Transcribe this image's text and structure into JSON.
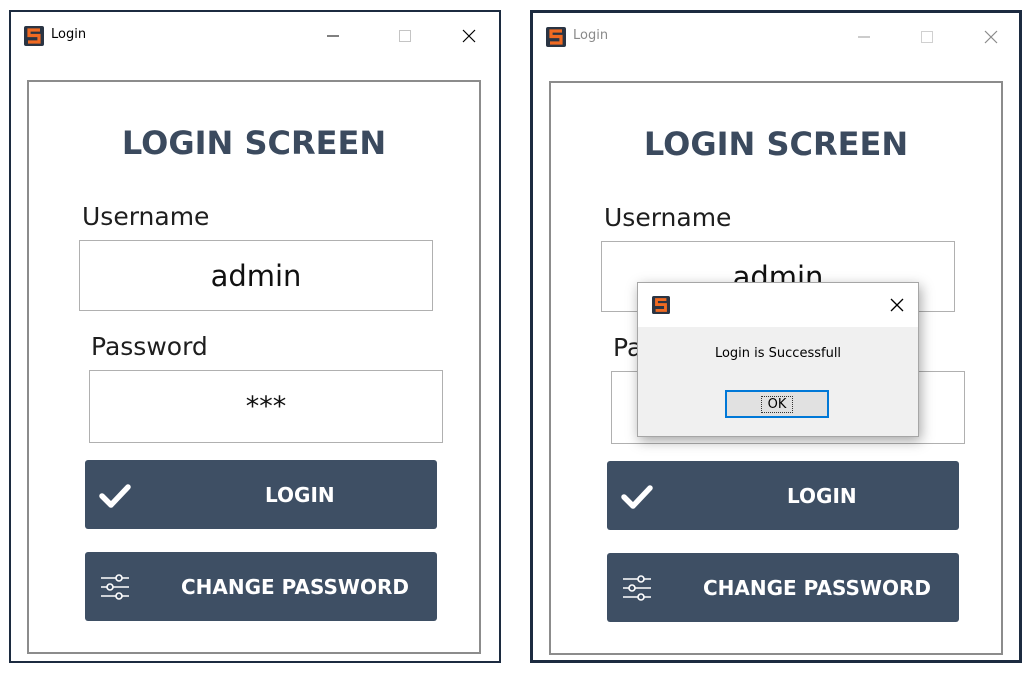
{
  "colors": {
    "window_border": "#1c2b40",
    "title_text": "#3b4a5e",
    "button_bg": "#3e4f64",
    "logo_orange": "#f06a22",
    "dialog_ok_border": "#0078d7"
  },
  "windows": [
    {
      "title": "Login",
      "controls": [
        "minimize-icon",
        "maximize-icon",
        "close-icon"
      ],
      "screen_title": "LOGIN SCREEN",
      "username_label": "Username",
      "username_value": "admin",
      "password_label": "Password",
      "password_value": "***",
      "login_button": "LOGIN",
      "change_password_button": "CHANGE PASSWORD",
      "icons": {
        "login": "checkmark-icon",
        "change": "sliders-icon"
      }
    },
    {
      "title": "Login",
      "controls": [
        "minimize-icon",
        "maximize-icon",
        "close-icon"
      ],
      "screen_title": "LOGIN SCREEN",
      "username_label": "Username",
      "username_value": "admin",
      "password_label": "Password",
      "password_value": "***",
      "login_button": "LOGIN",
      "change_password_button": "CHANGE PASSWORD",
      "icons": {
        "login": "checkmark-icon",
        "change": "sliders-icon"
      }
    }
  ],
  "dialog": {
    "message": "Login is Successfull",
    "ok_label": "OK",
    "icons": {
      "logo": "app-logo-icon",
      "close": "close-icon"
    }
  }
}
